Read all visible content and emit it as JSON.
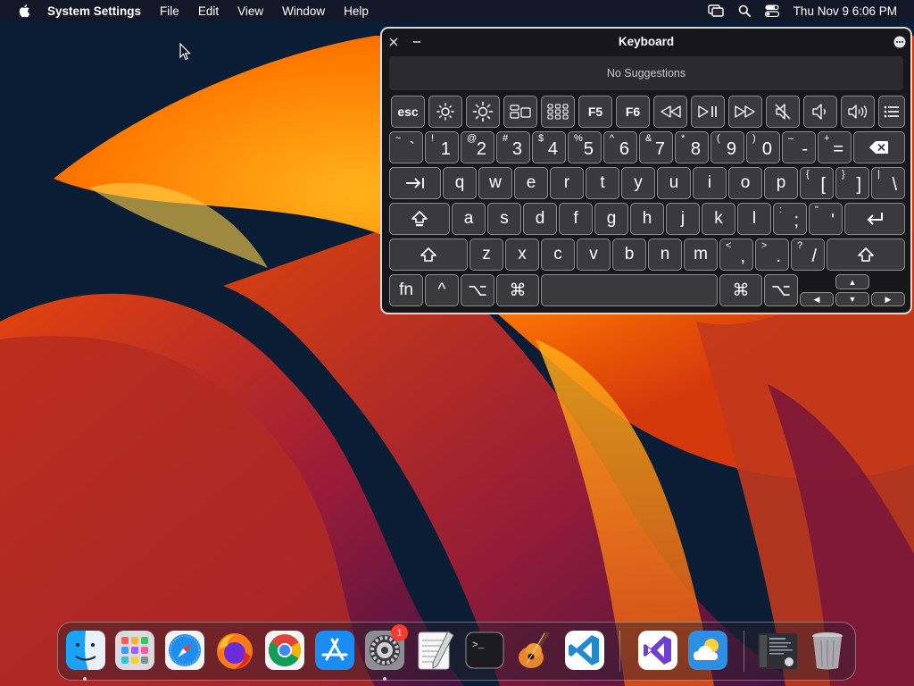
{
  "menubar": {
    "app_name": "System Settings",
    "menus": [
      "File",
      "Edit",
      "View",
      "Window",
      "Help"
    ],
    "clock": "Thu Nov 9  6:06 PM",
    "status_icons": [
      "display-mirroring-icon",
      "search-icon",
      "control-center-icon"
    ]
  },
  "keyboard_viewer": {
    "title": "Keyboard",
    "suggestions": "No Suggestions",
    "fn_row": [
      {
        "label": "esc",
        "icon": ""
      },
      {
        "label": "",
        "icon": "brightness-down-icon"
      },
      {
        "label": "",
        "icon": "brightness-up-icon"
      },
      {
        "label": "",
        "icon": "mission-control-icon"
      },
      {
        "label": "",
        "icon": "launchpad-icon"
      },
      {
        "label": "F5",
        "icon": ""
      },
      {
        "label": "F6",
        "icon": ""
      },
      {
        "label": "",
        "icon": "rewind-icon"
      },
      {
        "label": "",
        "icon": "play-pause-icon"
      },
      {
        "label": "",
        "icon": "fast-forward-icon"
      },
      {
        "label": "",
        "icon": "mute-icon"
      },
      {
        "label": "",
        "icon": "volume-down-icon"
      },
      {
        "label": "",
        "icon": "volume-up-icon"
      },
      {
        "label": "",
        "icon": "list-icon"
      }
    ],
    "number_row": [
      {
        "sub": "~",
        "main": "`"
      },
      {
        "sub": "!",
        "main": "1"
      },
      {
        "sub": "@",
        "main": "2"
      },
      {
        "sub": "#",
        "main": "3"
      },
      {
        "sub": "$",
        "main": "4"
      },
      {
        "sub": "%",
        "main": "5"
      },
      {
        "sub": "^",
        "main": "6"
      },
      {
        "sub": "&",
        "main": "7"
      },
      {
        "sub": "*",
        "main": "8"
      },
      {
        "sub": "(",
        "main": "9"
      },
      {
        "sub": ")",
        "main": "0"
      },
      {
        "sub": "–",
        "main": "-"
      },
      {
        "sub": "+",
        "main": "="
      }
    ],
    "q_row": [
      "q",
      "w",
      "e",
      "r",
      "t",
      "y",
      "u",
      "i",
      "o",
      "p"
    ],
    "q_row_symbols": [
      {
        "sub": "{",
        "main": "["
      },
      {
        "sub": "}",
        "main": "]"
      },
      {
        "sub": "|",
        "main": "\\"
      }
    ],
    "a_row": [
      "a",
      "s",
      "d",
      "f",
      "g",
      "h",
      "j",
      "k",
      "l"
    ],
    "a_row_symbols": [
      {
        "sub": ":",
        "main": ";"
      },
      {
        "sub": "\"",
        "main": "'"
      }
    ],
    "z_row": [
      "z",
      "x",
      "c",
      "v",
      "b",
      "n",
      "m"
    ],
    "z_row_symbols": [
      {
        "sub": "<",
        "main": ","
      },
      {
        "sub": ">",
        "main": "."
      },
      {
        "sub": "?",
        "main": "/"
      }
    ],
    "bottom_row": {
      "fn": "fn",
      "control": "^",
      "option": "⌥",
      "command": "⌘",
      "arrow_up": "▲",
      "arrow_down": "▼",
      "arrow_left": "◀",
      "arrow_right": "▶"
    }
  },
  "dock": {
    "apps": [
      {
        "name": "Finder",
        "icon": "finder-icon",
        "running": true
      },
      {
        "name": "Launchpad",
        "icon": "launchpad-icon",
        "running": false
      },
      {
        "name": "Safari",
        "icon": "safari-icon",
        "running": false
      },
      {
        "name": "Firefox",
        "icon": "firefox-icon",
        "running": false
      },
      {
        "name": "Chrome",
        "icon": "chrome-icon",
        "running": false
      },
      {
        "name": "App Store",
        "icon": "app-store-icon",
        "running": false
      },
      {
        "name": "System Settings",
        "icon": "system-settings-icon",
        "running": true,
        "badge": "1"
      },
      {
        "name": "TextEdit",
        "icon": "textedit-icon",
        "running": false
      },
      {
        "name": "Terminal",
        "icon": "terminal-icon",
        "running": false
      },
      {
        "name": "GarageBand",
        "icon": "garageband-icon",
        "running": false
      },
      {
        "name": "Visual Studio Code",
        "icon": "vscode-icon",
        "running": false
      },
      {
        "name": "Visual Studio",
        "icon": "visual-studio-icon",
        "running": false
      },
      {
        "name": "Weather",
        "icon": "weather-icon",
        "running": false
      },
      {
        "name": "Screenshot",
        "icon": "screenshot-stack-icon",
        "running": false
      },
      {
        "name": "Trash",
        "icon": "trash-icon",
        "running": false
      }
    ],
    "terminal_prompt": ">_"
  }
}
